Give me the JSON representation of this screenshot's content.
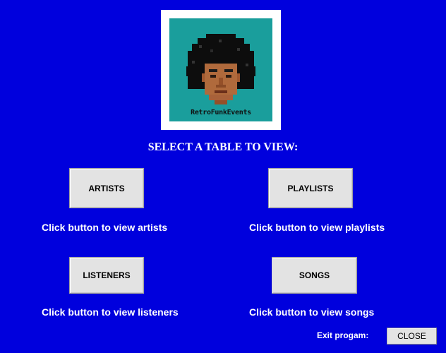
{
  "colors": {
    "background": "#0000dd",
    "button": "#e3e3e3",
    "text": "#ffffff"
  },
  "logo": {
    "icon": "retro-funk-avatar-icon",
    "text": "RetroFunkEvents"
  },
  "heading": "SELECT A TABLE TO VIEW:",
  "buttons": {
    "artists": "ARTISTS",
    "playlists": "PLAYLISTS",
    "listeners": "LISTENERS",
    "songs": "SONGS"
  },
  "hints": {
    "artists": "Click button to view artists",
    "playlists": "Click button to view playlists",
    "listeners": "Click button to view listeners",
    "songs": "Click button to view songs"
  },
  "footer": {
    "exit_label": "Exit progam:",
    "close_label": "CLOSE"
  }
}
